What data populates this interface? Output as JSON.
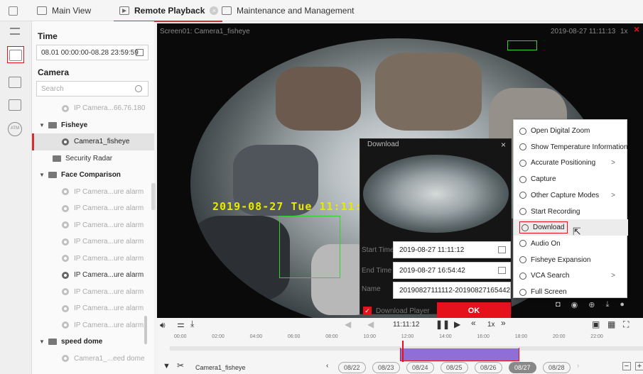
{
  "tabs": [
    {
      "label": "Main View",
      "active": false
    },
    {
      "label": "Remote Playback",
      "active": true
    },
    {
      "label": "Maintenance and Management",
      "active": false
    }
  ],
  "left": {
    "time_title": "Time",
    "time_range": "08.01 00:00:00-08.28 23:59:59",
    "camera_title": "Camera",
    "search_placeholder": "Search",
    "tree": [
      {
        "label": "IP Camera...66.76.180",
        "kind": "camera"
      },
      {
        "label": "Fisheye",
        "kind": "group"
      },
      {
        "label": "Camera1_fisheye",
        "kind": "camera-selected"
      },
      {
        "label": "Security Radar",
        "kind": "folder"
      },
      {
        "label": "Face Comparison",
        "kind": "group"
      },
      {
        "label": "IP Camera...ure alarm",
        "kind": "camera"
      },
      {
        "label": "IP Camera...ure alarm",
        "kind": "camera"
      },
      {
        "label": "IP Camera...ure alarm",
        "kind": "camera"
      },
      {
        "label": "IP Camera...ure alarm",
        "kind": "camera"
      },
      {
        "label": "IP Camera...ure alarm",
        "kind": "camera"
      },
      {
        "label": "IP Camera...ure alarm",
        "kind": "camera-online"
      },
      {
        "label": "IP Camera...ure alarm",
        "kind": "camera"
      },
      {
        "label": "IP Camera...ure alarm",
        "kind": "camera"
      },
      {
        "label": "IP Camera...ure alarm",
        "kind": "camera"
      },
      {
        "label": "speed dome",
        "kind": "group"
      },
      {
        "label": "Camera1_...eed dome",
        "kind": "camera"
      }
    ]
  },
  "video": {
    "screen_label": "Screen01: Camera1_fisheye",
    "timestamp": "2019-08-27 11:11:13",
    "speed": "1x",
    "osd": "2019-08-27 Tue 11:11:1"
  },
  "download": {
    "title": "Download",
    "start_label": "Start Time",
    "start_value": "2019-08-27 11:11:12",
    "end_label": "End Time",
    "end_value": "2019-08-27 16:54:42",
    "name_label": "Name",
    "name_value": "20190827111112-20190827165442",
    "player_label": "Download Player",
    "ok": "OK"
  },
  "menu": [
    {
      "label": "Open Digital Zoom",
      "icon": "zoom-icon",
      "sub": false
    },
    {
      "label": "Show Temperature Information",
      "icon": "thermometer-icon",
      "sub": false
    },
    {
      "label": "Accurate Positioning",
      "icon": "clock-icon",
      "sub": true
    },
    {
      "label": "Capture",
      "icon": "camera-icon",
      "sub": false
    },
    {
      "label": "Other Capture Modes",
      "icon": "camera-icon",
      "sub": true
    },
    {
      "label": "Start Recording",
      "icon": "record-icon",
      "sub": false
    },
    {
      "label": "Download",
      "icon": "download-icon",
      "sub": false
    },
    {
      "label": "Audio On",
      "icon": "speaker-icon",
      "sub": false
    },
    {
      "label": "Fisheye Expansion",
      "icon": "fisheye-icon",
      "sub": false
    },
    {
      "label": "VCA Search",
      "icon": "shield-icon",
      "sub": true
    },
    {
      "label": "Full Screen",
      "icon": "fullscreen-icon",
      "sub": false
    }
  ],
  "controls": {
    "time": "11:11:12",
    "speed": "1x",
    "camera": "Camera1_fisheye",
    "ticks": [
      "00:00",
      "02:00",
      "04:00",
      "06:00",
      "08:00",
      "10:00",
      "12:00",
      "14:00",
      "16:00",
      "18:00",
      "20:00",
      "22:00"
    ],
    "dates": [
      "08/22",
      "08/23",
      "08/24",
      "08/25",
      "08/26",
      "08/27",
      "08/28"
    ],
    "current_date": "08/27"
  }
}
